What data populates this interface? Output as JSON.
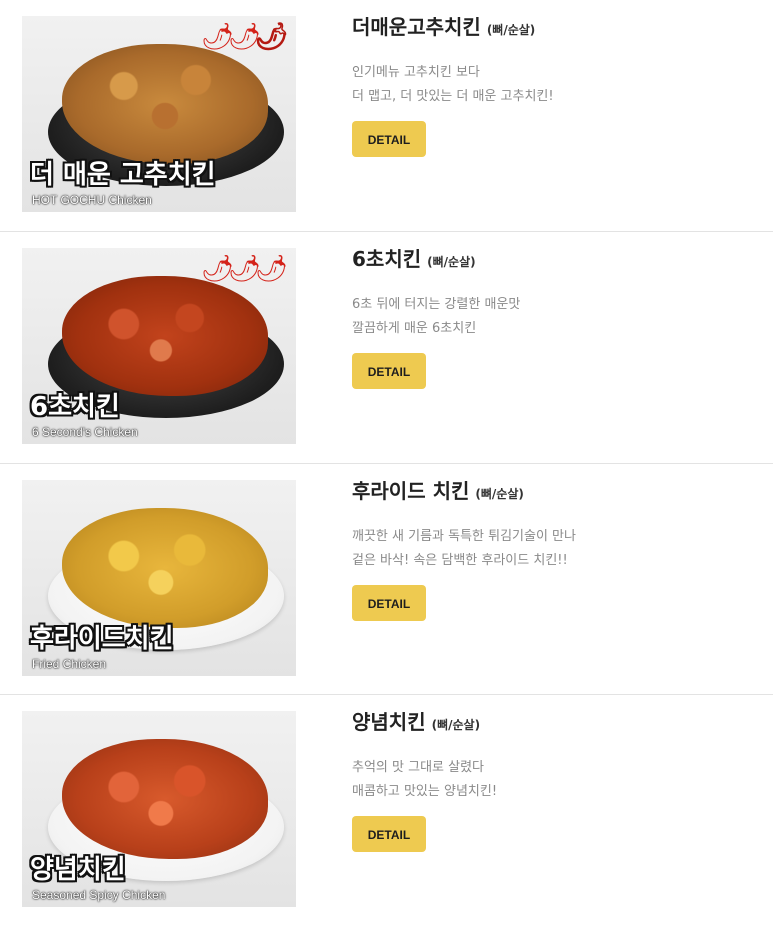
{
  "menu": [
    {
      "name": "더매운고추치킨",
      "type": "(뼈/순살)",
      "desc": [
        "인기메뉴 고추치킨 보다",
        "더 맵고, 더 맛있는 더 매운 고추치킨!"
      ],
      "button": "DETAIL",
      "image_title": "더 매운 고추치킨",
      "image_subtitle": "HOT GOCHU Chicken",
      "spice_icon": "chili-pepper-icon"
    },
    {
      "name": "6초치킨",
      "type": "(뼈/순살)",
      "desc": [
        "6초 뒤에 터지는 강렬한 매운맛",
        "깔끔하게 매운 6초치킨"
      ],
      "button": "DETAIL",
      "image_title": "6초치킨",
      "image_subtitle": "6 Second's Chicken",
      "spice_icon": "chili-pepper-icon"
    },
    {
      "name": "후라이드 치킨",
      "type": "(뼈/순살)",
      "desc": [
        "깨끗한 새 기름과 독특한 튀김기술이 만나",
        "겉은 바삭! 속은 담백한 후라이드 치킨!!"
      ],
      "button": "DETAIL",
      "image_title": "후라이드치킨",
      "image_subtitle": "Fried Chicken"
    },
    {
      "name": "양념치킨",
      "type": "(뼈/순살)",
      "desc": [
        "추억의 맛 그대로 살렸다",
        "매콤하고 맛있는 양념치킨!"
      ],
      "button": "DETAIL",
      "image_title": "양념치킨",
      "image_subtitle": "Seasoned Spicy Chicken"
    }
  ],
  "colors": {
    "button_bg": "#eeca50",
    "title": "#222222",
    "desc": "#8a8a8a",
    "pepper": "#d4231a"
  }
}
